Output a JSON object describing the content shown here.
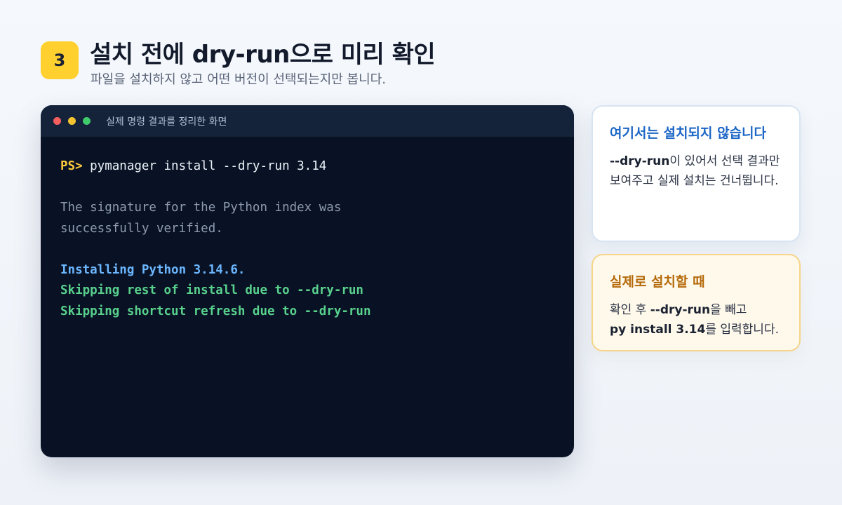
{
  "header": {
    "step_number": "3",
    "title": "설치 전에 dry-run으로 미리 확인",
    "subtitle": "파일을 설치하지 않고 어떤 버전이 선택되는지만 봅니다."
  },
  "terminal": {
    "window_title": "실제 명령 결과를 정리한 화면",
    "prompt": "PS>",
    "command": " pymanager install --dry-run 3.14",
    "output_muted": [
      "The signature for the Python index was",
      "successfully verified."
    ],
    "output_info": "Installing Python 3.14.6.",
    "output_ok": [
      "Skipping rest of install due to --dry-run",
      "Skipping shortcut refresh due to --dry-run"
    ]
  },
  "card_note": {
    "heading": "여기서는 설치되지 않습니다",
    "flag": "--dry-run",
    "text_after_flag": "이 있어서 선택 결과만 보여주고 실제 설치는 건너뜁니다."
  },
  "card_real": {
    "heading": "실제로 설치할 때",
    "text_prefix": "확인 후 ",
    "flag": "--dry-run",
    "text_mid": "을 빼고",
    "command": "py install 3.14",
    "text_suffix": "를 입력합니다."
  },
  "colors": {
    "badge": "#ffd02e",
    "prompt": "#ffcb3d",
    "info": "#6cb6ff",
    "ok": "#59d18d",
    "note_heading": "#1c66c6",
    "real_heading": "#b56a0a"
  }
}
